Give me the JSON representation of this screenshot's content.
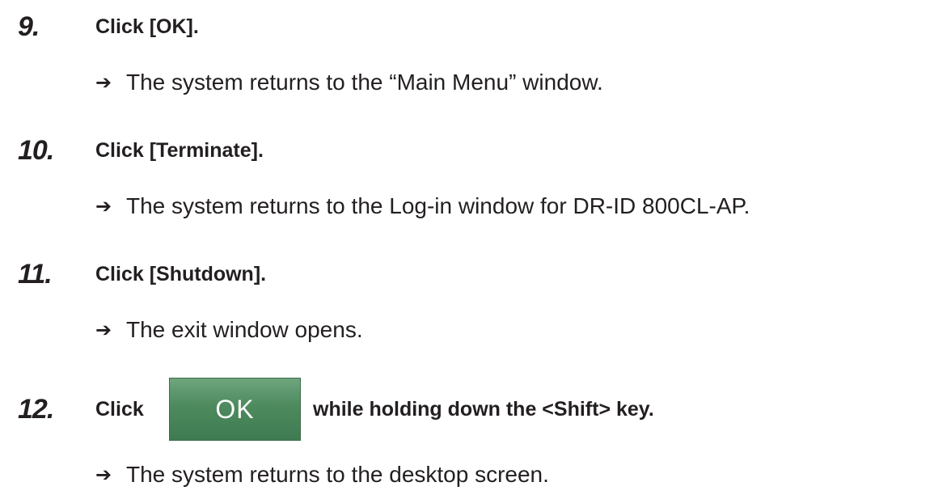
{
  "steps": [
    {
      "number": "9.",
      "instruction": "Click [OK].",
      "result": "The system returns to the “Main Menu” window."
    },
    {
      "number": "10.",
      "instruction": "Click [Terminate].",
      "result": "The system returns to the Log-in window for DR-ID 800CL-AP."
    },
    {
      "number": "11.",
      "instruction": "Click [Shutdown].",
      "result": "The exit window opens."
    },
    {
      "number": "12.",
      "instruction_prefix": "Click",
      "button_label": "OK",
      "instruction_suffix": "while holding down the <Shift> key.",
      "result": "The system returns to the desktop screen."
    }
  ],
  "arrow_glyph": "➔",
  "colors": {
    "text": "#231f20",
    "ok_button_top": "#6fa57d",
    "ok_button_bottom": "#3f7b50",
    "ok_button_text": "#ffffff"
  }
}
